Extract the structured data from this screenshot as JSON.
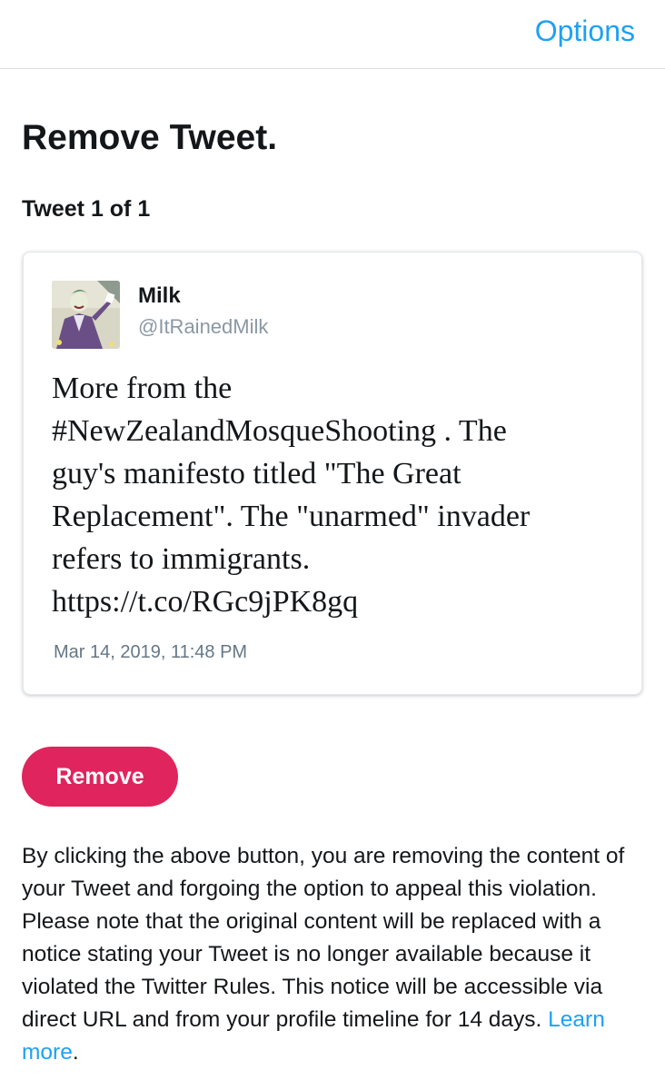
{
  "header": {
    "options_label": "Options"
  },
  "page": {
    "title": "Remove Tweet.",
    "tweet_count": "Tweet 1 of 1"
  },
  "tweet": {
    "author_name": "Milk",
    "author_handle": "@ItRainedMilk",
    "text": "More from the\n#NewZealandMosqueShooting . The\nguy's manifesto titled \"The Great\nReplacement\". The \"unarmed\" invader\nrefers to immigrants.\nhttps://t.co/RGc9jPK8gq",
    "timestamp": "Mar 14, 2019, 11:48 PM",
    "avatar_icon": "cartoon-character-avatar"
  },
  "actions": {
    "remove_label": "Remove"
  },
  "disclaimer": {
    "text": "By clicking the above button, you are removing the content of your Tweet and forgoing the option to appeal this violation. Please note that the original content will be replaced with a notice stating your Tweet is no longer available because it violated the Twitter Rules. This notice will be accessible via direct URL and from your profile timeline for 14 days. ",
    "learn_more_label": "Learn more",
    "trailing": "."
  },
  "colors": {
    "accent_blue": "#1da1f2",
    "remove_red": "#e0245e",
    "handle_gray": "#8a98a5"
  }
}
